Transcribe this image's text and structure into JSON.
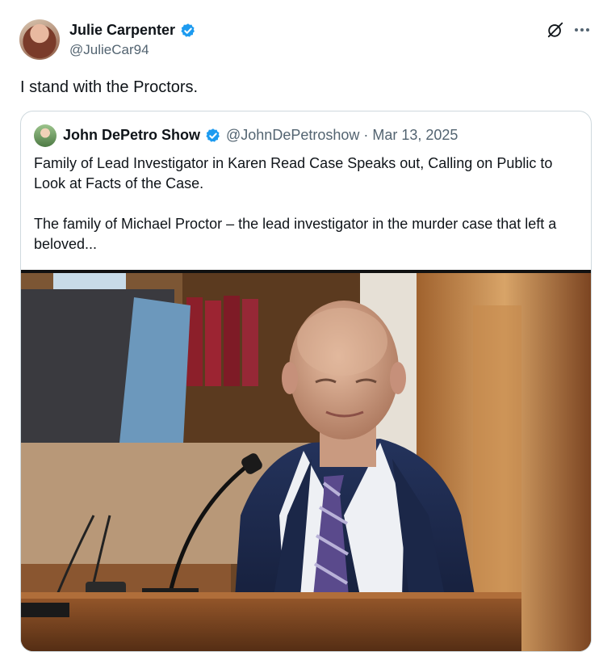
{
  "post": {
    "author_name": "Julie Carpenter",
    "author_handle": "@JulieCar94",
    "text": "I stand with the Proctors.",
    "icons": [
      "grok-icon",
      "more-icon",
      "verified-icon"
    ]
  },
  "quote": {
    "author_name": "John DePetro Show",
    "meta": "@JohnDePetroshow · Mar 13, 2025",
    "paragraph1": "Family of Lead Investigator in Karen Read Case Speaks out, Calling on Public to Look at Facts of the Case.",
    "paragraph2": "The family of Michael Proctor – the lead investigator in the murder case that left a beloved...",
    "image_alt": "Man in suit and striped tie testifying at a courtroom witness stand microphone"
  },
  "colors": {
    "verified": "#1d9bf0",
    "text_primary": "#0f1419",
    "text_secondary": "#536471",
    "border": "#cfd9de"
  }
}
